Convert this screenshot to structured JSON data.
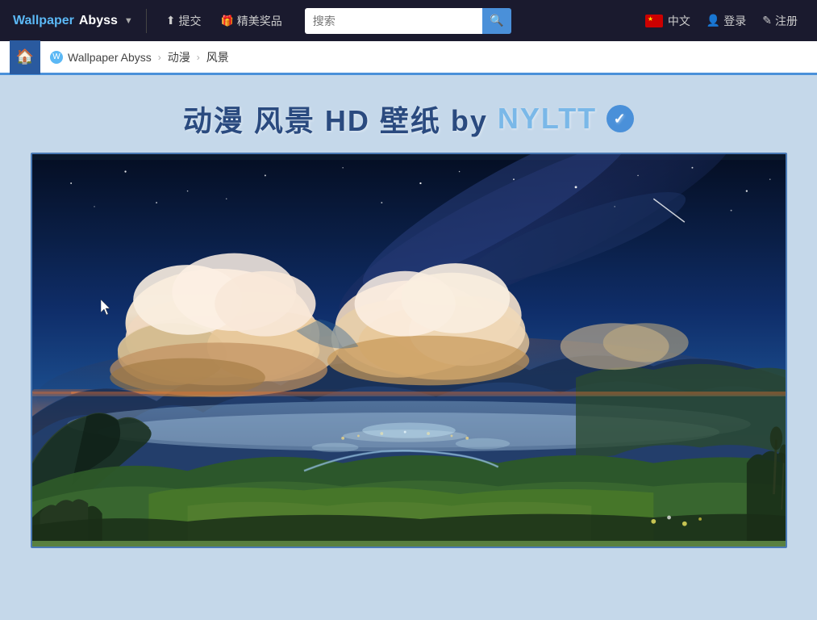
{
  "navbar": {
    "brand": {
      "wallpaper": "Wallpaper",
      "abyss": " Abyss",
      "dropdown_label": "▼"
    },
    "links": [
      {
        "id": "submit",
        "icon": "⬆",
        "label": "提交"
      },
      {
        "id": "featured",
        "icon": "🎁",
        "label": "精美奖品"
      }
    ],
    "search": {
      "placeholder": "搜索",
      "button_icon": "🔍"
    },
    "language": {
      "label": "中文",
      "flag": "🇨🇳"
    },
    "auth": {
      "login_icon": "👤",
      "login_label": "登录",
      "register_icon": "✎",
      "register_label": "注册"
    }
  },
  "breadcrumb": {
    "home_icon": "🏠",
    "site_icon": "W",
    "site_label": "Wallpaper Abyss",
    "cat1": "动漫",
    "cat2": "风景"
  },
  "page": {
    "title_part1": "动漫 风景 HD 壁纸 by ",
    "title_author": "NYLTT",
    "verified_checkmark": "✓"
  },
  "wallpaper": {
    "alt": "Anime landscape HD wallpaper - night sky with mountains and fields"
  }
}
